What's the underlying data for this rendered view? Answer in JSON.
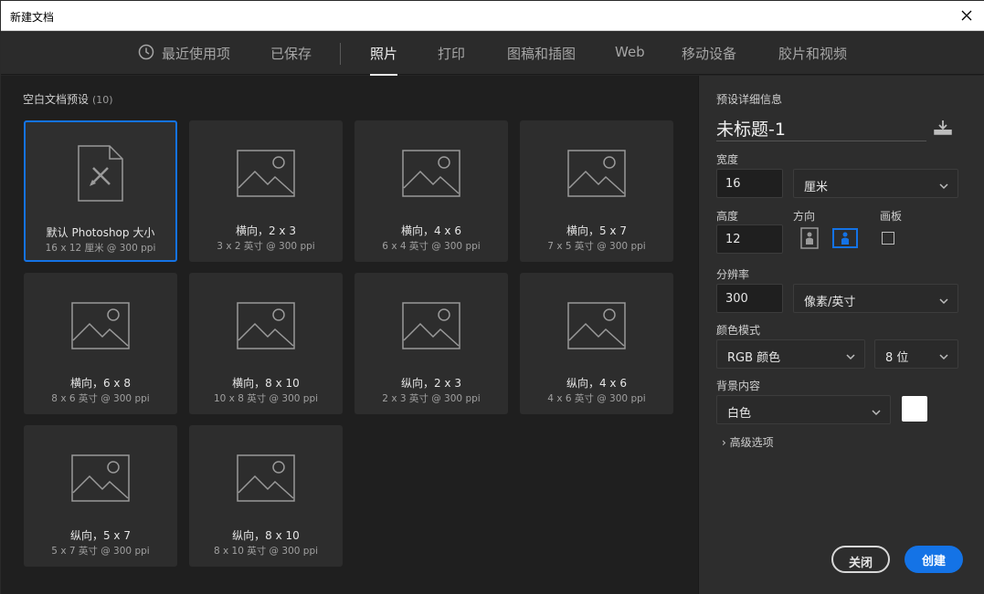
{
  "window": {
    "title": "新建文档"
  },
  "tabs": [
    {
      "label": "最近使用项"
    },
    {
      "label": "已保存"
    },
    {
      "label": "照片"
    },
    {
      "label": "打印"
    },
    {
      "label": "图稿和插图"
    },
    {
      "label": "Web"
    },
    {
      "label": "移动设备"
    },
    {
      "label": "胶片和视频"
    }
  ],
  "presets": {
    "label": "空白文档预设",
    "count": "(10)",
    "items": [
      {
        "name": "默认 Photoshop 大小",
        "sub": "16 x 12 厘米 @ 300 ppi",
        "icon": "document-icon"
      },
      {
        "name": "横向，2 x 3",
        "sub": "3 x 2 英寸 @ 300 ppi",
        "icon": "image-icon"
      },
      {
        "name": "横向，4 x 6",
        "sub": "6 x 4 英寸 @ 300 ppi",
        "icon": "image-icon"
      },
      {
        "name": "横向，5 x 7",
        "sub": "7 x 5 英寸 @ 300 ppi",
        "icon": "image-icon"
      },
      {
        "name": "横向，6 x 8",
        "sub": "8 x 6 英寸 @ 300 ppi",
        "icon": "image-icon"
      },
      {
        "name": "横向，8 x 10",
        "sub": "10 x 8 英寸 @ 300 ppi",
        "icon": "image-icon"
      },
      {
        "name": "纵向，2 x 3",
        "sub": "2 x 3 英寸 @ 300 ppi",
        "icon": "image-icon"
      },
      {
        "name": "纵向，4 x 6",
        "sub": "4 x 6 英寸 @ 300 ppi",
        "icon": "image-icon"
      },
      {
        "name": "纵向，5 x 7",
        "sub": "5 x 7 英寸 @ 300 ppi",
        "icon": "image-icon"
      },
      {
        "name": "纵向，8 x 10",
        "sub": "8 x 10 英寸 @ 300 ppi",
        "icon": "image-icon"
      }
    ]
  },
  "details": {
    "heading": "预设详细信息",
    "doc_name": "未标题-1",
    "width_label": "宽度",
    "width_value": "16",
    "width_unit": "厘米",
    "height_label": "高度",
    "height_value": "12",
    "orientation_label": "方向",
    "artboard_label": "画板",
    "resolution_label": "分辨率",
    "resolution_value": "300",
    "resolution_unit": "像素/英寸",
    "color_mode_label": "颜色模式",
    "color_mode_value": "RGB 颜色",
    "bit_depth_value": "8 位",
    "background_label": "背景内容",
    "background_value": "白色",
    "background_color": "#ffffff",
    "advanced_label": "高级选项"
  },
  "buttons": {
    "close_label": "关闭",
    "create_label": "创建"
  },
  "colors": {
    "accent": "#1473e6"
  }
}
